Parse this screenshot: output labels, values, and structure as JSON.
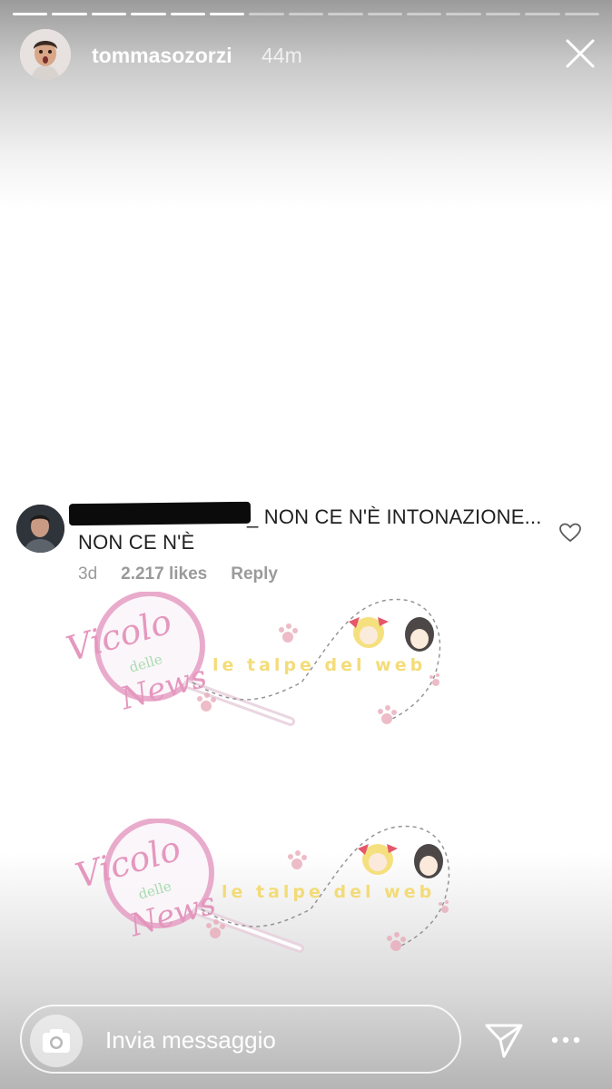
{
  "story": {
    "progress_total": 15,
    "progress_done": 6,
    "username": "tommasozorzi",
    "time_ago": "44m"
  },
  "comment": {
    "text_tail": "_ NON CE N'È INTONAZIONE... NON CE N'È",
    "age": "3d",
    "likes": "2.217 likes",
    "reply_label": "Reply"
  },
  "watermark": {
    "logo_vicolo": "Vicolo",
    "logo_delle": "delle",
    "logo_news": "News",
    "tagline": "le talpe del web"
  },
  "reply_bar": {
    "placeholder": "Invia messaggio"
  },
  "colors": {
    "accent_white": "#ffffff",
    "watermark_pink": "#e38db8",
    "watermark_yellow": "#f3d96a",
    "comment_text": "#1f1f1f",
    "meta_gray": "#9a9a9a"
  }
}
